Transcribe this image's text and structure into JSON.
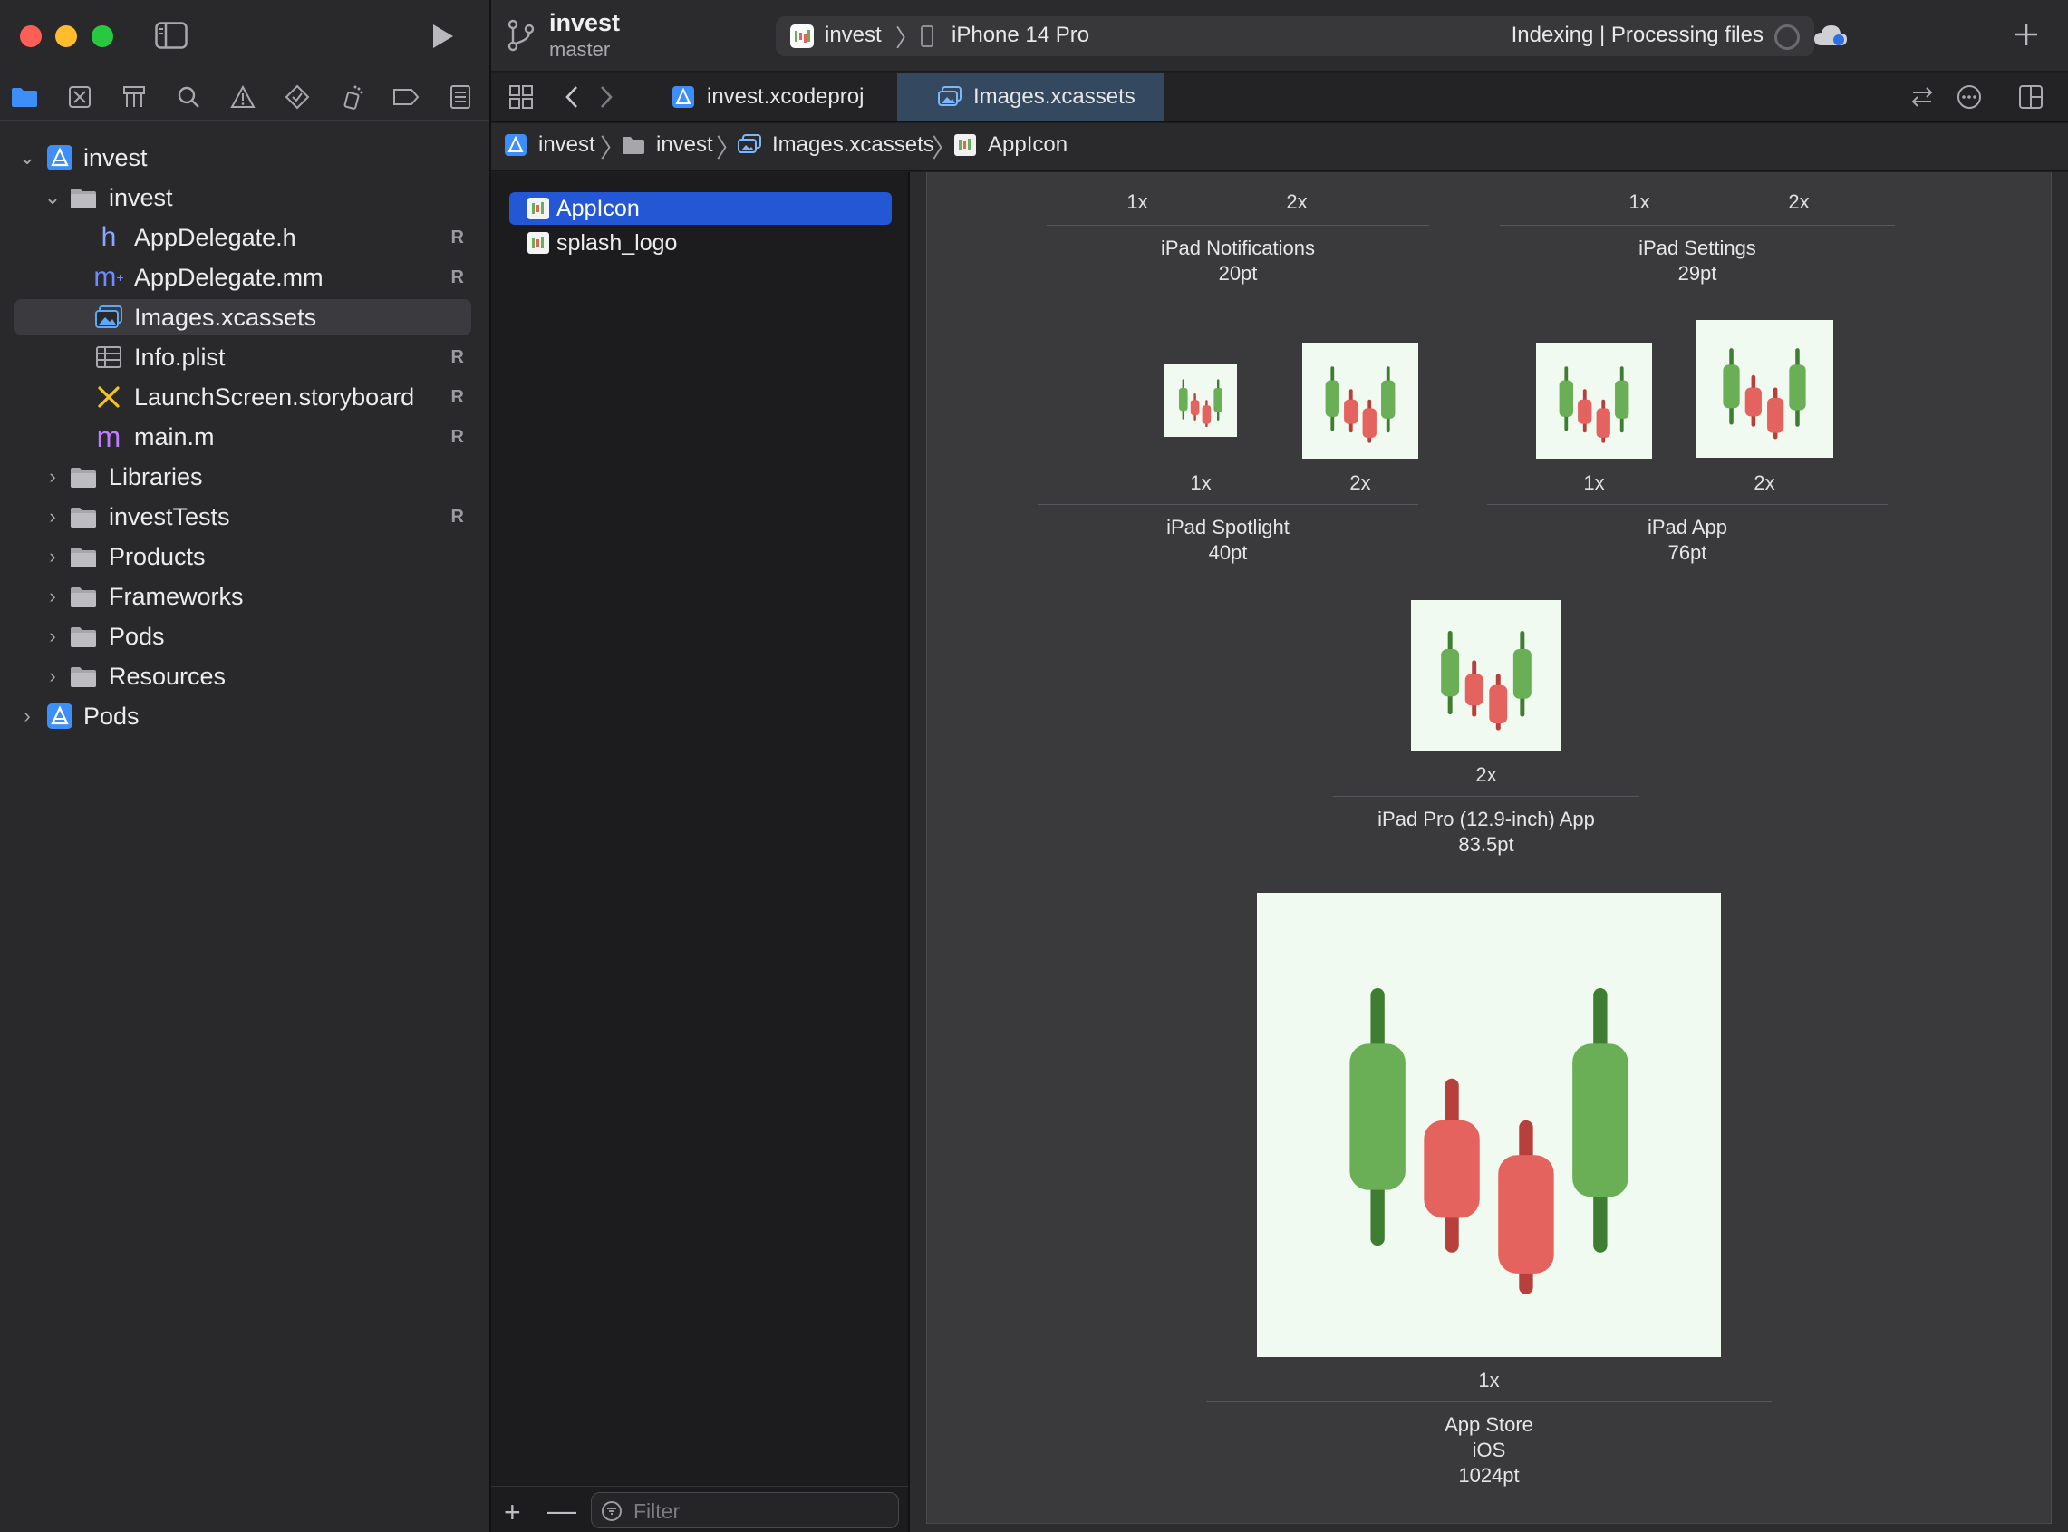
{
  "navigator": {
    "tree": [
      {
        "label": "invest",
        "badge": ""
      },
      {
        "label": "invest",
        "badge": ""
      },
      {
        "label": "AppDelegate.h",
        "badge": "R"
      },
      {
        "label": "AppDelegate.mm",
        "badge": "R"
      },
      {
        "label": "Images.xcassets",
        "badge": ""
      },
      {
        "label": "Info.plist",
        "badge": "R"
      },
      {
        "label": "LaunchScreen.storyboard",
        "badge": "R"
      },
      {
        "label": "main.m",
        "badge": "R"
      },
      {
        "label": "Libraries",
        "badge": ""
      },
      {
        "label": "investTests",
        "badge": "R"
      },
      {
        "label": "Products",
        "badge": ""
      },
      {
        "label": "Frameworks",
        "badge": ""
      },
      {
        "label": "Pods",
        "badge": ""
      },
      {
        "label": "Resources",
        "badge": ""
      },
      {
        "label": "Pods",
        "badge": ""
      }
    ]
  },
  "toolbar": {
    "project": "invest",
    "branch": "master",
    "scheme": "invest",
    "device": "iPhone 14 Pro",
    "status": "Indexing | Processing files"
  },
  "tabs": [
    "invest.xcodeproj",
    "Images.xcassets"
  ],
  "breadcrumb": [
    "invest",
    "invest",
    "Images.xcassets",
    "AppIcon"
  ],
  "assets": {
    "items": [
      "AppIcon",
      "splash_logo"
    ],
    "filter_placeholder": "Filter",
    "add_label": "+",
    "remove_label": "—"
  },
  "canvas": {
    "scales": {
      "s1x": "1x",
      "s2x": "2x"
    },
    "groups": {
      "ipad_notifications": {
        "name": "iPad Notifications",
        "size": "20pt"
      },
      "ipad_settings": {
        "name": "iPad Settings",
        "size": "29pt"
      },
      "ipad_spotlight": {
        "name": "iPad Spotlight",
        "size": "40pt"
      },
      "ipad_app": {
        "name": "iPad App",
        "size": "76pt"
      },
      "ipad_pro": {
        "name": "iPad Pro (12.9-inch) App",
        "size": "83.5pt"
      },
      "app_store": {
        "name": "App Store",
        "platform": "iOS",
        "size": "1024pt"
      }
    }
  },
  "colors": {
    "accent": "#2457d4",
    "candle_green": "#6aae55",
    "candle_green_wick": "#3f7d33",
    "candle_red": "#e5635f",
    "candle_red_wick": "#b8403c",
    "icon_bg": "#f1faf0"
  }
}
